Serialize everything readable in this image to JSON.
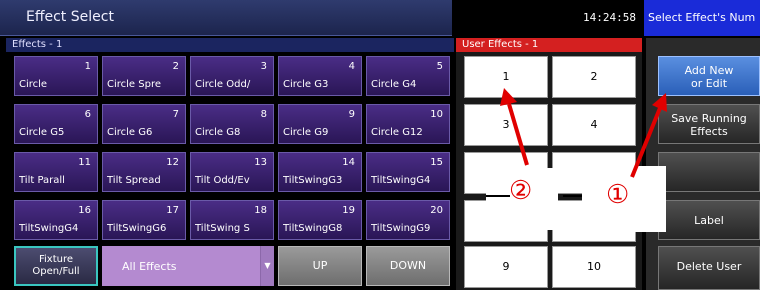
{
  "title": "Effect Select",
  "clock": "14:24:58",
  "hint": "Select Effect's Num",
  "effects_header": "Effects - 1",
  "effects": [
    {
      "num": "1",
      "label": "Circle"
    },
    {
      "num": "2",
      "label": "Circle Spre"
    },
    {
      "num": "3",
      "label": "Circle Odd/"
    },
    {
      "num": "4",
      "label": "Circle G3"
    },
    {
      "num": "5",
      "label": "Circle G4"
    },
    {
      "num": "6",
      "label": "Circle G5"
    },
    {
      "num": "7",
      "label": "Circle G6"
    },
    {
      "num": "8",
      "label": "Circle G8"
    },
    {
      "num": "9",
      "label": "Circle G9"
    },
    {
      "num": "10",
      "label": "Circle G12"
    },
    {
      "num": "11",
      "label": "Tilt Parall"
    },
    {
      "num": "12",
      "label": "Tilt Spread"
    },
    {
      "num": "13",
      "label": "Tilt Odd/Ev"
    },
    {
      "num": "14",
      "label": "TiltSwingG3"
    },
    {
      "num": "15",
      "label": "TiltSwingG4"
    },
    {
      "num": "16",
      "label": "TiltSwingG4"
    },
    {
      "num": "17",
      "label": "TiltSwingG6"
    },
    {
      "num": "18",
      "label": "TiltSwing S"
    },
    {
      "num": "19",
      "label": "TiltSwingG8"
    },
    {
      "num": "20",
      "label": "TiltSwingG9"
    }
  ],
  "bottom": {
    "fixture_line1": "Fixture",
    "fixture_line2": "Open/Full",
    "all_effects": "All Effects",
    "up": "UP",
    "down": "DOWN"
  },
  "user_header": "User Effects - 1",
  "user_cells": [
    "1",
    "2",
    "3",
    "4",
    "",
    "",
    "",
    "",
    "9",
    "10"
  ],
  "side": {
    "add_new_1": "Add New",
    "add_new_2": "or Edit",
    "save_1": "Save Running",
    "save_2": "Effects",
    "label": "Label",
    "delete": "Delete User"
  },
  "annotations": {
    "marker_1": "①",
    "marker_2": "②"
  },
  "colors": {
    "title_bar": "#2f3b6e",
    "effect_button": "#4a2d86",
    "user_header": "#d42020",
    "hint_bar": "#1a2bd8",
    "annotation": "#e00000"
  }
}
